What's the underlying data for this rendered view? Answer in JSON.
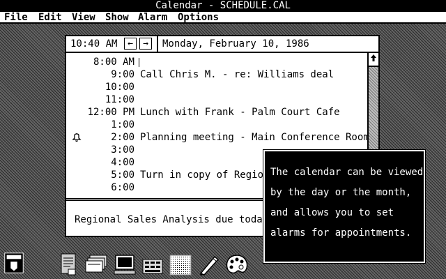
{
  "window": {
    "title": "Calendar - SCHEDULE.CAL"
  },
  "menu": [
    "File",
    "Edit",
    "View",
    "Show",
    "Alarm",
    "Options"
  ],
  "calendar": {
    "current_time": "10:40 AM",
    "prev_symbol": "←",
    "next_symbol": "→",
    "date": "Monday, February 10, 1986",
    "rows": [
      {
        "time": "8:00 AM",
        "event": ""
      },
      {
        "time": "9:00",
        "event": "Call Chris M. - re: Williams deal"
      },
      {
        "time": "10:00",
        "event": ""
      },
      {
        "time": "11:00",
        "event": ""
      },
      {
        "time": "12:00 PM",
        "event": "Lunch with Frank - Palm Court Cafe"
      },
      {
        "time": "1:00",
        "event": ""
      },
      {
        "time": "2:00",
        "event": "Planning meeting - Main Conference Room"
      },
      {
        "time": "3:00",
        "event": ""
      },
      {
        "time": "4:00",
        "event": ""
      },
      {
        "time": "5:00",
        "event": "Turn in copy of Regional"
      },
      {
        "time": "6:00",
        "event": ""
      }
    ],
    "notes": "Regional Sales Analysis due today!"
  },
  "tooltip": {
    "lines": [
      "The calendar can be viewed",
      "by the day or the month,",
      "and allows you to set",
      "alarms for appointments."
    ]
  },
  "icons": {
    "alarm": "bell-icon",
    "tray": [
      "ms-dos-executive-icon",
      "notepad-icon",
      "cardfile-icon",
      "terminal-icon",
      "calculator-icon",
      "paint-canvas-icon",
      "write-pen-icon",
      "paint-palette-icon"
    ]
  }
}
